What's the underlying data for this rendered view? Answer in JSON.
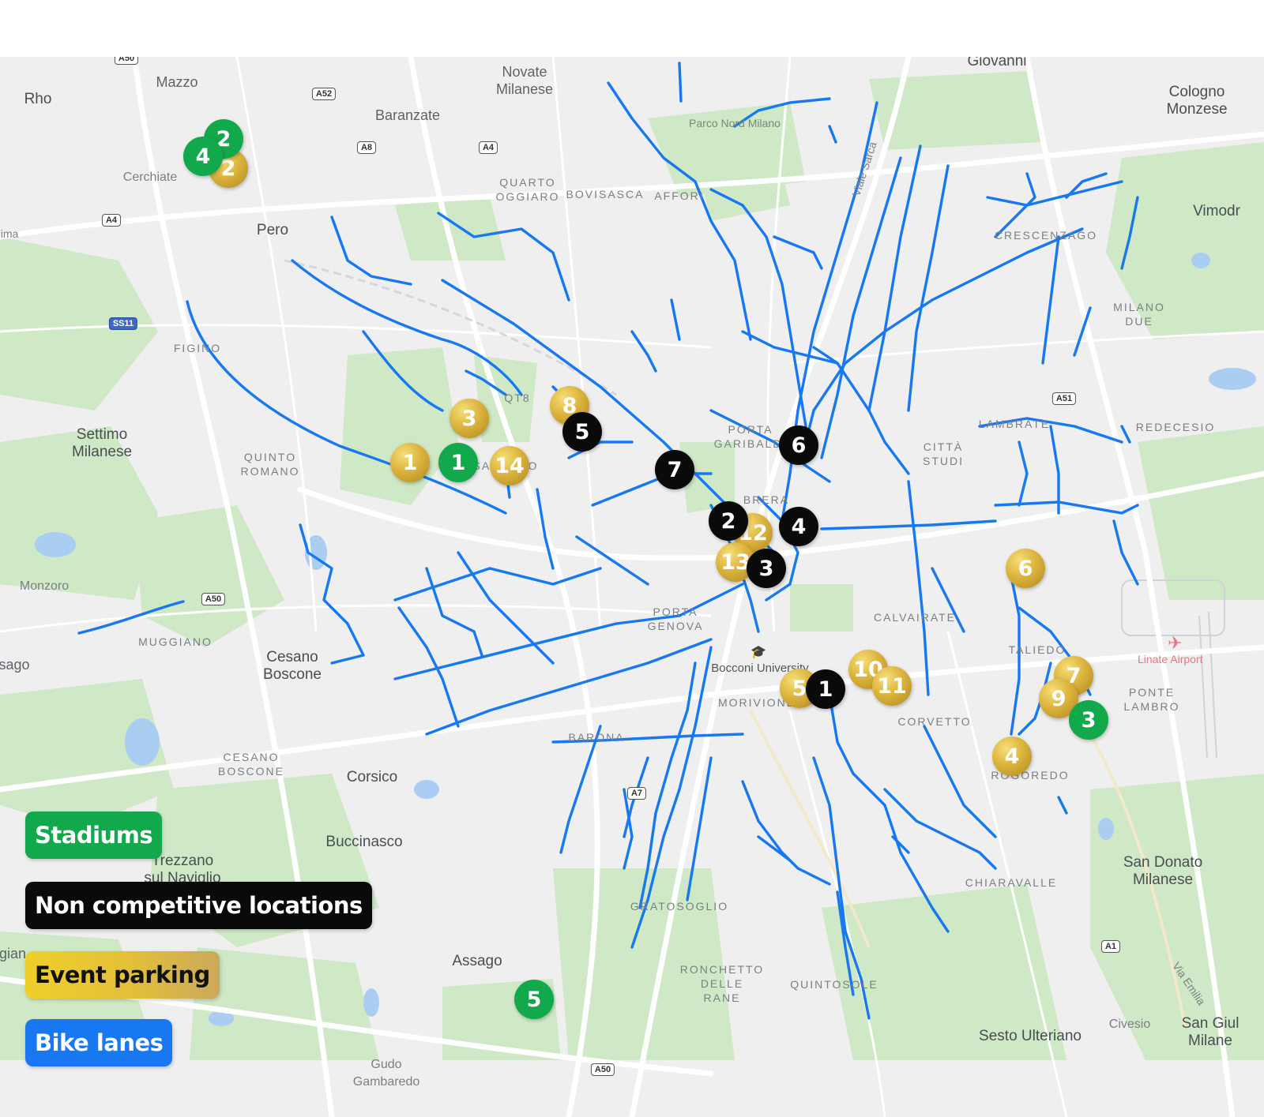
{
  "map": {
    "places": {
      "rho": "Rho",
      "mazzo": "Mazzo",
      "novate": "Novate\nMilanese",
      "baranzate": "Baranzate",
      "giovanni": "Giovanni",
      "cologno": "Cologno\nMonzese",
      "cerchiate": "Cerchiate",
      "pero": "Pero",
      "vimodr": "Vimodr",
      "ima": "ima",
      "settimo": "Settimo\nMilanese",
      "monzoro": "Monzoro",
      "sago": "sago",
      "cesano": "Cesano\nBoscone",
      "corsico": "Corsico",
      "buccinasco": "Buccinasco",
      "trezzano": "Trezzano\nsul Naviglio",
      "assago": "Assago",
      "gudo": "Gudo\nGambaredo",
      "san_donato": "San Donato\nMilanese",
      "sesto_ulteriano": "Sesto Ulteriano",
      "civesio": "Civesio",
      "san_giul": "San Giul\nMilane",
      "gian": "gian",
      "viale_sarca": "Viale Sarca",
      "via_emilia": "Via Emilia",
      "bocconi": "Bocconi University",
      "parco_nord": "Parco Nord Milano",
      "linate": "Linate Airport"
    },
    "districts": {
      "quarto": "QUARTO\nOGGIARO",
      "bovisasca": "BOVISASCA",
      "affori": "AFFORI",
      "crescenzago": "CRESCENZAGO",
      "milano_due": "MILANO\nDUE",
      "figino": "FIGINO",
      "qt8": "QT8",
      "quinto_romano": "QUINTO\nROMANO",
      "porta_garibaldi": "PORTA\nGARIBALDI",
      "brera": "BRERA",
      "citta_studi": "CITTÀ\nSTUDI",
      "lambrate": "LAMBRATE",
      "redecesio": "REDECESIO",
      "calvairate": "CALVAIRATE",
      "talie": "TALIEDO",
      "ponte_lambro": "PONTE\nLAMBRO",
      "porta_genova": "PORTA\nGENOVA",
      "muggiano": "MUGGIANO",
      "morivione": "MORIVIONE",
      "corvetto": "CORVETTO",
      "rogoredo": "ROGOREDO",
      "barona": "BARONA",
      "cesano_boscone": "CESANO\nBOSCONE",
      "chiaravalle": "CHIARAVALLE",
      "gratosoglio": "GRATOSOGLIO",
      "ronchetto": "RONCHETTO\nDELLE\nRANE",
      "quintosole": "QUINTOSOLE",
      "san_siro": "SAN SIRO"
    },
    "shields": {
      "a50_top": "A50",
      "a52": "A52",
      "a8": "A8",
      "a4_top": "A4",
      "a4_left": "A4",
      "ss11": "SS11",
      "a50_mid": "A50",
      "a51": "A51",
      "a7": "A7",
      "a1": "A1",
      "a50_bottom": "A50"
    }
  },
  "markers": {
    "stadiums": [
      "1",
      "2",
      "3",
      "4",
      "5"
    ],
    "non_competitive": [
      "1",
      "2",
      "3",
      "4",
      "5",
      "6",
      "7"
    ],
    "parking": [
      "1",
      "2",
      "3",
      "4",
      "5",
      "6",
      "7",
      "8",
      "9",
      "10",
      "11",
      "12",
      "13",
      "14"
    ]
  },
  "legend": {
    "stadiums": "Stadiums",
    "non_competitive": "Non competitive locations",
    "event_parking": "Event parking",
    "bike_lanes": "Bike lanes"
  },
  "colors": {
    "stadium": "#12a84c",
    "non_competitive": "#0a0a0a",
    "parking_gold": "#dcb33c",
    "bike_lane": "#1778f2",
    "park_green": "#cfe8c6",
    "water": "#aacdf2"
  }
}
